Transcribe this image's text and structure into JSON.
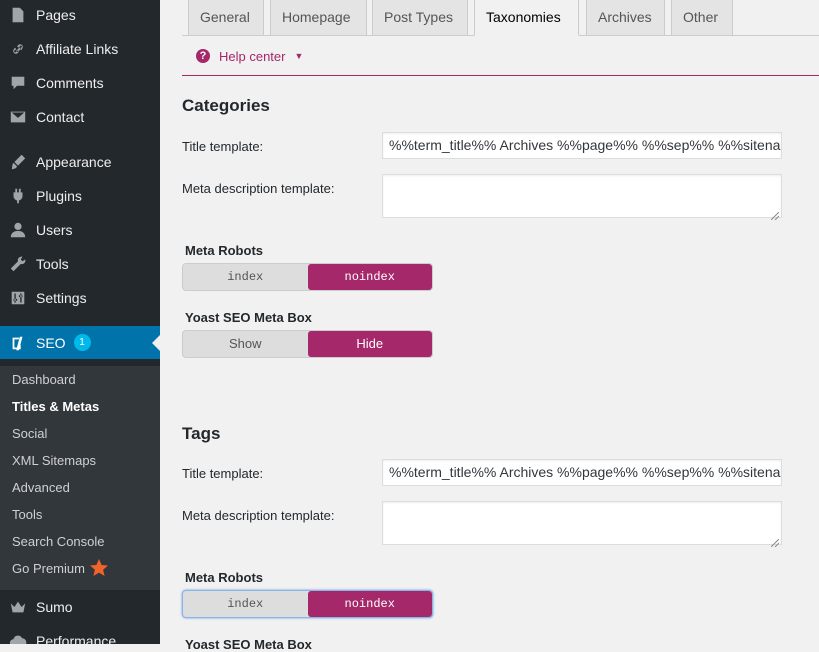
{
  "sidebar": {
    "menu": {
      "pages": "Pages",
      "affiliate_links": "Affiliate Links",
      "comments": "Comments",
      "contact": "Contact",
      "appearance": "Appearance",
      "plugins": "Plugins",
      "users": "Users",
      "tools": "Tools",
      "settings": "Settings",
      "seo": "SEO",
      "seo_badge": "1",
      "sumo": "Sumo",
      "performance": "Performance"
    },
    "submenu": {
      "dashboard": "Dashboard",
      "titles_metas": "Titles & Metas",
      "social": "Social",
      "xml_sitemaps": "XML Sitemaps",
      "advanced": "Advanced",
      "tools": "Tools",
      "search_console": "Search Console",
      "go_premium": "Go Premium"
    }
  },
  "tabs": {
    "general": "General",
    "homepage": "Homepage",
    "post_types": "Post Types",
    "taxonomies": "Taxonomies",
    "archives": "Archives",
    "other": "Other",
    "active": "Taxonomies"
  },
  "help": {
    "label": "Help center"
  },
  "categories": {
    "heading": "Categories",
    "title_label": "Title template:",
    "title_value": "%%term_title%% Archives %%page%% %%sep%% %%sitename%%",
    "meta_label": "Meta description template:",
    "robots_label": "Meta Robots",
    "robots_index": "index",
    "robots_noindex": "noindex",
    "robots_selected": "noindex",
    "metabox_label": "Yoast SEO Meta Box",
    "metabox_show": "Show",
    "metabox_hide": "Hide",
    "metabox_selected": "Hide"
  },
  "tags": {
    "heading": "Tags",
    "title_label": "Title template:",
    "title_value": "%%term_title%% Archives %%page%% %%sep%% %%sitename%%",
    "meta_label": "Meta description template:",
    "robots_label": "Meta Robots",
    "robots_index": "index",
    "robots_noindex": "noindex",
    "robots_selected": "noindex",
    "metabox_label": "Yoast SEO Meta Box"
  },
  "colors": {
    "accent": "#a4286a",
    "sidebar_bg": "#23282d",
    "active_menu": "#0073aa",
    "premium_star": "#f0632a"
  },
  "icons": {
    "pages": "pages-icon",
    "affiliate_links": "link-icon",
    "comments": "comment-icon",
    "contact": "envelope-icon",
    "appearance": "paintbrush-icon",
    "plugins": "plug-icon",
    "users": "user-icon",
    "tools": "wrench-icon",
    "settings": "sliders-icon",
    "seo": "yoast-icon",
    "sumo": "crown-icon",
    "performance": "cloud-icon",
    "help": "question-circle-icon",
    "premium": "star-icon"
  }
}
